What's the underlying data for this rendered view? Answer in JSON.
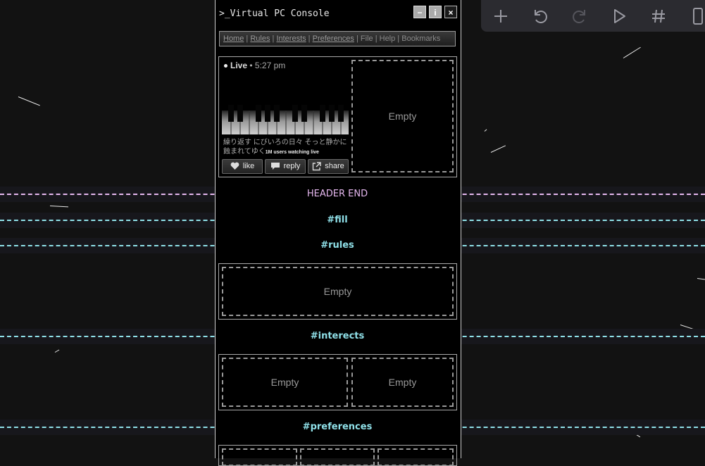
{
  "window": {
    "title": ">_Virtual PC Console",
    "minimize_label": "−",
    "info_label": "i",
    "close_label": "×"
  },
  "nav": {
    "items": [
      {
        "label": "Home",
        "link": true
      },
      {
        "label": "Rules",
        "link": true
      },
      {
        "label": "Interests",
        "link": true
      },
      {
        "label": "Preferences",
        "link": true
      },
      {
        "label": "File",
        "link": false
      },
      {
        "label": "Help",
        "link": false
      },
      {
        "label": "Bookmarks",
        "link": false
      }
    ],
    "separator": " | "
  },
  "live": {
    "status": "Live",
    "time": "• 5:27 pm",
    "caption": "繰り返す にびいろの日々 そっと静かに蝕まれてゆく",
    "viewers": "1M users watching live",
    "like_label": "like",
    "reply_label": "reply",
    "share_label": "share"
  },
  "sections": {
    "header_end": "HEADER END",
    "fill": "#fill",
    "rules": "#rules",
    "interests": "#interects",
    "preferences": "#preferences"
  },
  "empty_label": "Empty",
  "colors": {
    "header_end": "#e6b8f0",
    "section": "#8fe0e8",
    "background": "#121212",
    "console_bg": "#000000"
  },
  "toolbar": {
    "icons": [
      "plus-icon",
      "undo-icon",
      "redo-icon",
      "play-icon",
      "hash-icon",
      "phone-icon"
    ]
  }
}
